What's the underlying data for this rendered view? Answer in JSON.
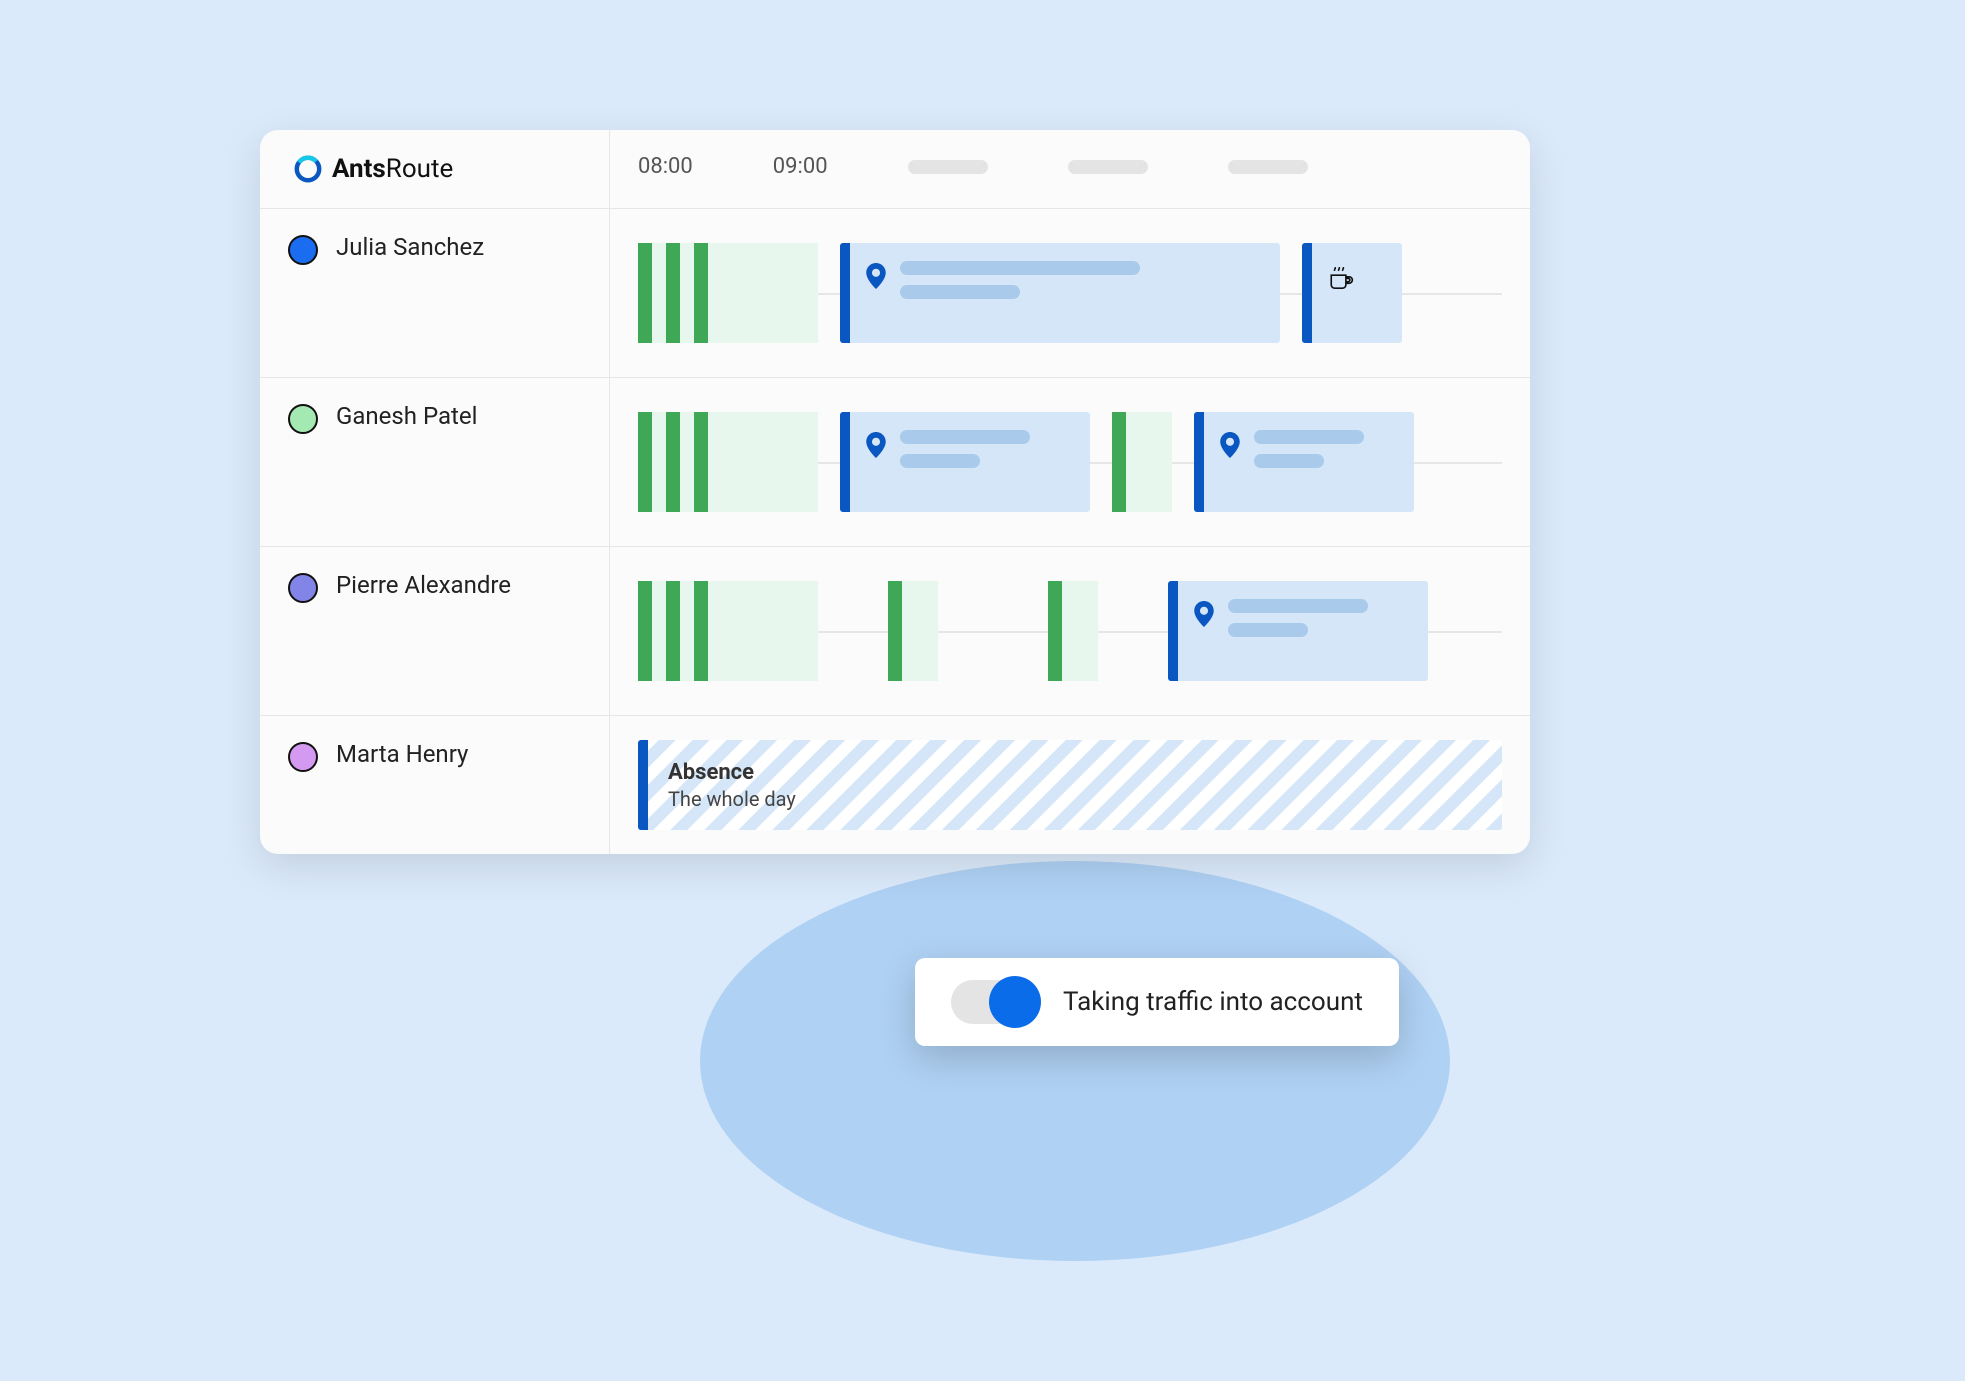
{
  "app": {
    "name_bold": "Ants",
    "name_light": "Route"
  },
  "timeline": {
    "times": [
      "08:00",
      "09:00"
    ]
  },
  "drivers": [
    {
      "name": "Julia Sanchez",
      "color": "#1A6CF0"
    },
    {
      "name": "Ganesh Patel",
      "color": "#A4E8B2"
    },
    {
      "name": "Pierre Alexandre",
      "color": "#8284E8"
    },
    {
      "name": "Marta Henry",
      "color": "#D49AF2"
    }
  ],
  "absence": {
    "title": "Absence",
    "subtitle": "The whole day"
  },
  "toggle": {
    "label": "Taking traffic into account"
  }
}
